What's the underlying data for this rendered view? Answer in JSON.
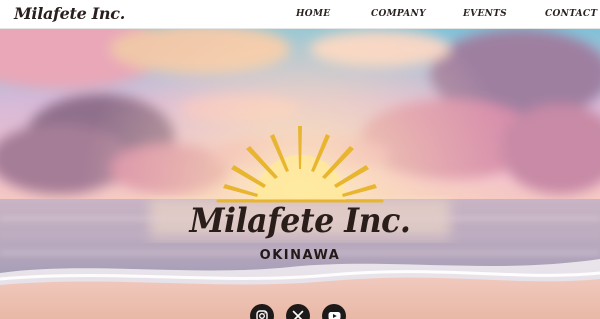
{
  "header": {
    "logo": "Milafete Inc.",
    "nav": [
      {
        "label": "HOME"
      },
      {
        "label": "COMPANY"
      },
      {
        "label": "EVENTS"
      },
      {
        "label": "CONTACT"
      }
    ]
  },
  "hero": {
    "title": "Milafete Inc.",
    "subtitle": "OKINAWA",
    "sun_color": "#e8b530"
  },
  "social": [
    {
      "icon": "instagram-icon"
    },
    {
      "icon": "x-icon"
    },
    {
      "icon": "youtube-icon"
    }
  ],
  "colors": {
    "text_dark": "#2a1e1b",
    "nav_bg": "#ffffff",
    "icon_bg": "#1d1a19"
  }
}
